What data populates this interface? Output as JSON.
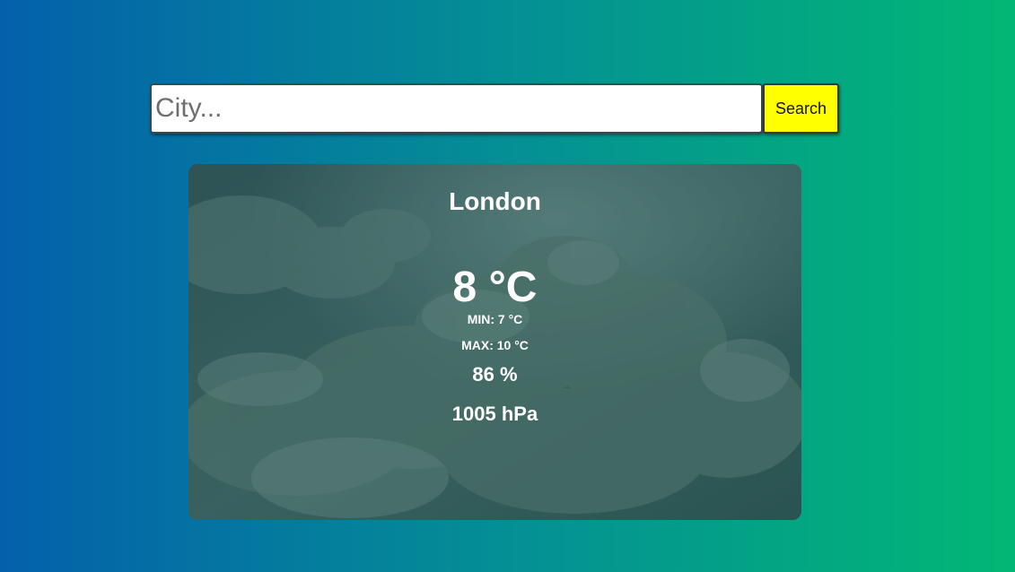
{
  "search": {
    "placeholder": "City...",
    "button_label": "Search"
  },
  "weather": {
    "city": "London",
    "temperature": "8 °C",
    "min": "MIN: 7 °C",
    "max": "MAX: 10 °C",
    "humidity": "86 %",
    "pressure": "1005 hPa"
  },
  "colors": {
    "background_start": "#0460ab",
    "background_end": "#02b775",
    "button": "#ffff00",
    "card_tint": "#34605d"
  }
}
